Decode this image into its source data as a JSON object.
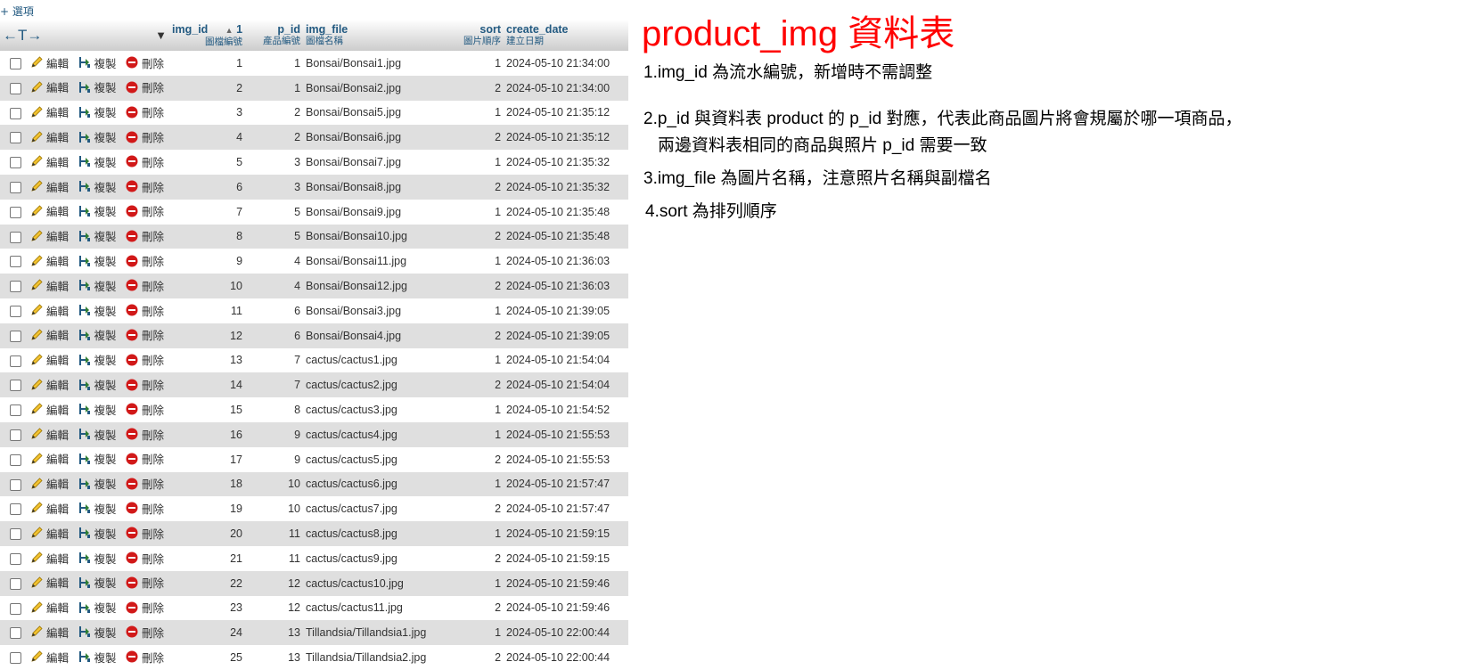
{
  "options_link": "+ 選項",
  "columns": {
    "arrows": "←T→",
    "menu": "▼",
    "img_id": {
      "name": "img_id",
      "sort_indicator": "▲",
      "sort_order": "1",
      "sub": "圖檔編號"
    },
    "p_id": {
      "name": "p_id",
      "sub": "產品編號"
    },
    "img_file": {
      "name": "img_file",
      "sub": "圖檔名稱"
    },
    "sort": {
      "name": "sort",
      "sub": "圖片順序"
    },
    "create_date": {
      "name": "create_date",
      "sub": "建立日期"
    }
  },
  "actions": {
    "edit": "編輯",
    "copy": "複製",
    "delete": "刪除"
  },
  "rows": [
    {
      "img_id": "1",
      "p_id": "1",
      "img_file": "Bonsai/Bonsai1.jpg",
      "sort": "1",
      "create_date": "2024-05-10 21:34:00"
    },
    {
      "img_id": "2",
      "p_id": "1",
      "img_file": "Bonsai/Bonsai2.jpg",
      "sort": "2",
      "create_date": "2024-05-10 21:34:00"
    },
    {
      "img_id": "3",
      "p_id": "2",
      "img_file": "Bonsai/Bonsai5.jpg",
      "sort": "1",
      "create_date": "2024-05-10 21:35:12"
    },
    {
      "img_id": "4",
      "p_id": "2",
      "img_file": "Bonsai/Bonsai6.jpg",
      "sort": "2",
      "create_date": "2024-05-10 21:35:12"
    },
    {
      "img_id": "5",
      "p_id": "3",
      "img_file": "Bonsai/Bonsai7.jpg",
      "sort": "1",
      "create_date": "2024-05-10 21:35:32"
    },
    {
      "img_id": "6",
      "p_id": "3",
      "img_file": "Bonsai/Bonsai8.jpg",
      "sort": "2",
      "create_date": "2024-05-10 21:35:32"
    },
    {
      "img_id": "7",
      "p_id": "5",
      "img_file": "Bonsai/Bonsai9.jpg",
      "sort": "1",
      "create_date": "2024-05-10 21:35:48"
    },
    {
      "img_id": "8",
      "p_id": "5",
      "img_file": "Bonsai/Bonsai10.jpg",
      "sort": "2",
      "create_date": "2024-05-10 21:35:48"
    },
    {
      "img_id": "9",
      "p_id": "4",
      "img_file": "Bonsai/Bonsai11.jpg",
      "sort": "1",
      "create_date": "2024-05-10 21:36:03"
    },
    {
      "img_id": "10",
      "p_id": "4",
      "img_file": "Bonsai/Bonsai12.jpg",
      "sort": "2",
      "create_date": "2024-05-10 21:36:03"
    },
    {
      "img_id": "11",
      "p_id": "6",
      "img_file": "Bonsai/Bonsai3.jpg",
      "sort": "1",
      "create_date": "2024-05-10 21:39:05"
    },
    {
      "img_id": "12",
      "p_id": "6",
      "img_file": "Bonsai/Bonsai4.jpg",
      "sort": "2",
      "create_date": "2024-05-10 21:39:05"
    },
    {
      "img_id": "13",
      "p_id": "7",
      "img_file": "cactus/cactus1.jpg",
      "sort": "1",
      "create_date": "2024-05-10 21:54:04"
    },
    {
      "img_id": "14",
      "p_id": "7",
      "img_file": "cactus/cactus2.jpg",
      "sort": "2",
      "create_date": "2024-05-10 21:54:04"
    },
    {
      "img_id": "15",
      "p_id": "8",
      "img_file": "cactus/cactus3.jpg",
      "sort": "1",
      "create_date": "2024-05-10 21:54:52"
    },
    {
      "img_id": "16",
      "p_id": "9",
      "img_file": "cactus/cactus4.jpg",
      "sort": "1",
      "create_date": "2024-05-10 21:55:53"
    },
    {
      "img_id": "17",
      "p_id": "9",
      "img_file": "cactus/cactus5.jpg",
      "sort": "2",
      "create_date": "2024-05-10 21:55:53"
    },
    {
      "img_id": "18",
      "p_id": "10",
      "img_file": "cactus/cactus6.jpg",
      "sort": "1",
      "create_date": "2024-05-10 21:57:47"
    },
    {
      "img_id": "19",
      "p_id": "10",
      "img_file": "cactus/cactus7.jpg",
      "sort": "2",
      "create_date": "2024-05-10 21:57:47"
    },
    {
      "img_id": "20",
      "p_id": "11",
      "img_file": "cactus/cactus8.jpg",
      "sort": "1",
      "create_date": "2024-05-10 21:59:15"
    },
    {
      "img_id": "21",
      "p_id": "11",
      "img_file": "cactus/cactus9.jpg",
      "sort": "2",
      "create_date": "2024-05-10 21:59:15"
    },
    {
      "img_id": "22",
      "p_id": "12",
      "img_file": "cactus/cactus10.jpg",
      "sort": "1",
      "create_date": "2024-05-10 21:59:46"
    },
    {
      "img_id": "23",
      "p_id": "12",
      "img_file": "cactus/cactus11.jpg",
      "sort": "2",
      "create_date": "2024-05-10 21:59:46"
    },
    {
      "img_id": "24",
      "p_id": "13",
      "img_file": "Tillandsia/Tillandsia1.jpg",
      "sort": "1",
      "create_date": "2024-05-10 22:00:44"
    },
    {
      "img_id": "25",
      "p_id": "13",
      "img_file": "Tillandsia/Tillandsia2.jpg",
      "sort": "2",
      "create_date": "2024-05-10 22:00:44"
    }
  ],
  "notes": {
    "title": "product_img 資料表",
    "item1": "1.img_id 為流水編號，新增時不需調整",
    "item2_line1": "2.p_id 與資料表 product 的 p_id 對應，代表此商品圖片將會規屬於哪一項商品，",
    "item2_line2": "兩邊資料表相同的商品與照片 p_id 需要一致",
    "item3": "3.img_file 為圖片名稱，注意照片名稱與副檔名",
    "item4": "4.sort 為排列順序"
  },
  "colors": {
    "title_red": "#ff0000",
    "link_blue": "#235a81",
    "row_even": "#dfdfdf",
    "delete_red": "#d11919"
  }
}
